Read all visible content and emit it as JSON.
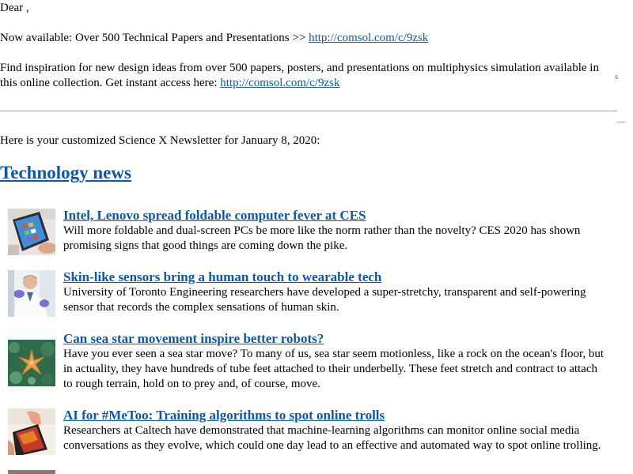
{
  "email": {
    "greeting": "Dear ,",
    "promo_text": "Now available: Over 500 Technical Papers and Presentations >> ",
    "promo_link": "http://comsol.com/c/9zsk",
    "inspire_text": "Find inspiration for new design ideas from over 500 papers, posters, and presentations on multiphysics simulation available in this online collection. Get instant access here: ",
    "inspire_link": "http://comsol.com/c/9zsk",
    "stray_mark": "s",
    "intro": "Here is your customized Science X Newsletter for January 8, 2020:"
  },
  "section": {
    "title": "Technology news"
  },
  "articles": [
    {
      "title": "Intel, Lenovo spread foldable computer fever at CES",
      "summary": "Will more foldable and dual-screen PCs be more like the norm rather than the novelty? CES 2020 has shown promising signs that good things are coming down the pike.",
      "thumbnail": "foldable-laptop-photo"
    },
    {
      "title": "Skin-like sensors bring a human touch to wearable tech",
      "summary": "University of Toronto Engineering researchers have developed a super-stretchy, transparent and self-powering sensor that records the complex sensations of human skin.",
      "thumbnail": "researcher-photo"
    },
    {
      "title": "Can sea star movement inspire better robots?",
      "summary": "Have you ever seen a sea star move? To many of us, sea star seem motionless, like a rock on the ocean's floor, but in actuality, they have hundreds of tube feet attached to their underbelly. These feet stretch and contract to attach to rough terrain, hold on to prey and, of course, move.",
      "thumbnail": "sea-star-photo"
    },
    {
      "title": "AI for #MeToo: Training algorithms to spot online trolls",
      "summary": "Researchers at Caltech have demonstrated that machine-learning algorithms can monitor online social media conversations as they evolve, which could one day lead to an effective and automated way to spot online trolling.",
      "thumbnail": "smartphone-hand-photo"
    }
  ]
}
